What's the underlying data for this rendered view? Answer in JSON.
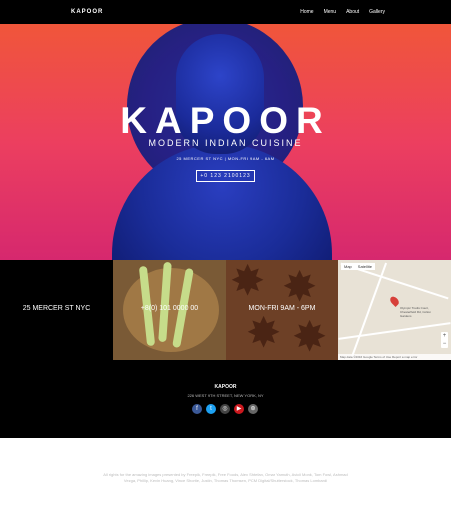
{
  "nav": {
    "logo": "KAPOOR",
    "links": [
      "Home",
      "Menu",
      "About",
      "Gallery"
    ]
  },
  "hero": {
    "title": "KAPOOR",
    "subtitle": "MODERN INDIAN CUISINE",
    "address_line": "25 MERCER ST NYC | MON-FRI 9AM - 6AM",
    "phone_button": "+0 123 2100123"
  },
  "tiles": {
    "address": "25 MERCER ST NYC",
    "phone": "+8(0) 101 0000 00",
    "hours": "MON-FRI 9AM - 6PM",
    "map": {
      "tab_map": "Map",
      "tab_satellite": "Satellite",
      "place": "Olympic Tredis Court, Chesterfield Rd, Colton Gardens",
      "footer": "Map data ©2016 Google   Terms of Use   Report a map error"
    }
  },
  "footer": {
    "name": "KAPOOR",
    "address": "226 WEST 9TH STREET, NEW YORK, NY",
    "socials": [
      "facebook-icon",
      "twitter-icon",
      "instagram-icon",
      "youtube-icon",
      "dribbble-icon"
    ],
    "colors": [
      "#3b5998",
      "#1da1f2",
      "#444444",
      "#cc181e",
      "#666666"
    ]
  },
  "credits": "All rights for the amazing images presented by Freepik, Freepik, Free Foods, Alex Shtefan, Omar Yamuth, Avicii Monk, Tom Fowl, Ashmad Vezga, Phillip, Kevin Huang, Vince Shortie, Justin, Thomas Thomsen, PCM Digital/Shutterstock, Thomas Lombardi"
}
